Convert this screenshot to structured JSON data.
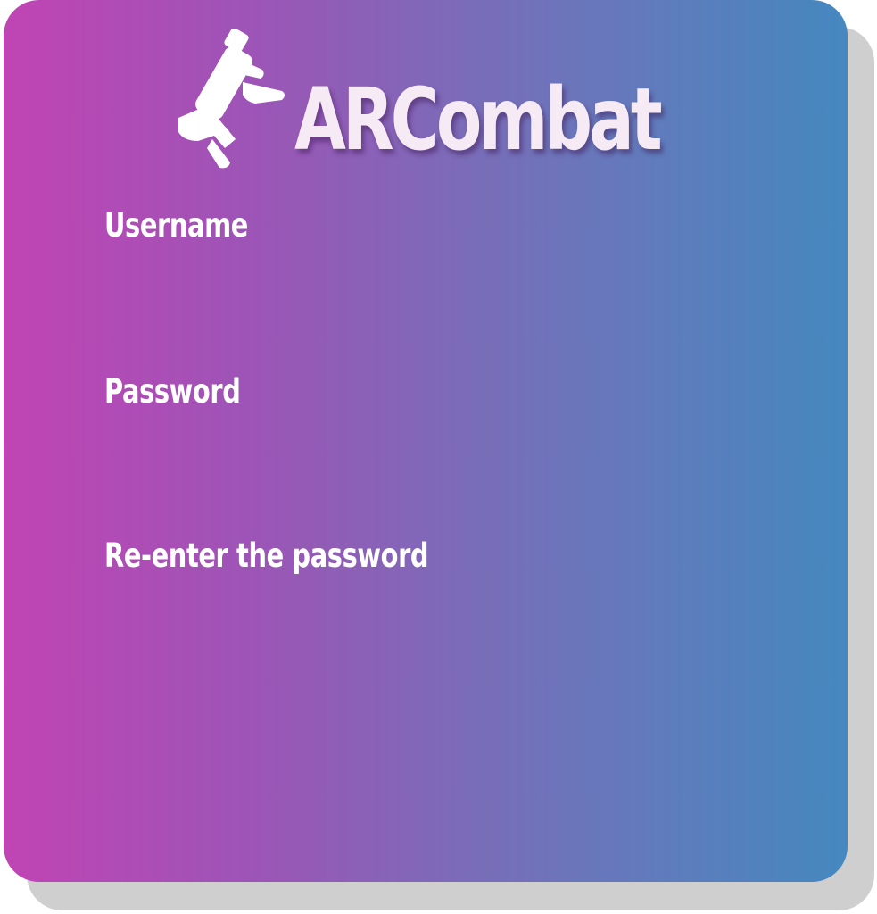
{
  "brand": {
    "title": "ARCombat",
    "logo_icon": "raygun-icon",
    "title_color": "#f6eaf4"
  },
  "theme": {
    "gradient_start": "#c044b4",
    "gradient_end": "#4588bf",
    "shadow": "#cfcfcf"
  },
  "form": {
    "username": {
      "label": "Username",
      "value": "",
      "placeholder": ""
    },
    "password": {
      "label": "Password",
      "value": "",
      "placeholder": ""
    },
    "confirm_password": {
      "label": "Re-enter the password",
      "value": "",
      "placeholder": ""
    }
  }
}
